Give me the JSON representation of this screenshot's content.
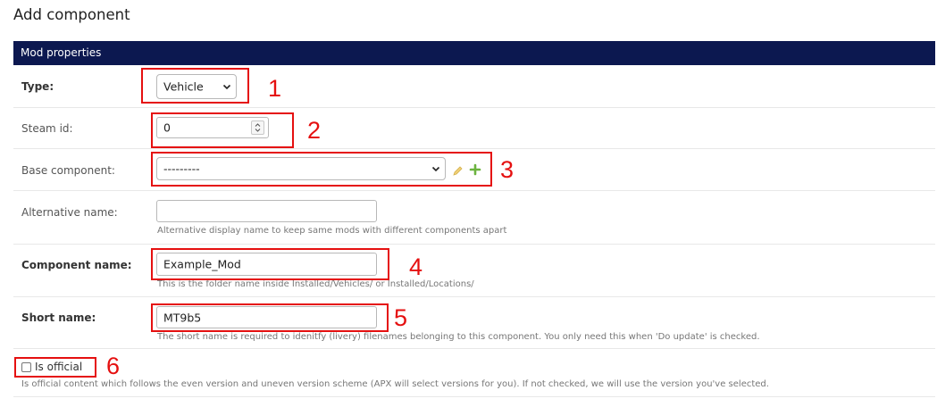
{
  "page": {
    "title": "Add component"
  },
  "section": {
    "title": "Mod properties"
  },
  "fields": {
    "type": {
      "label": "Type:",
      "value": "Vehicle",
      "annotation": "1"
    },
    "steam_id": {
      "label": "Steam id:",
      "value": "0",
      "annotation": "2"
    },
    "base_component": {
      "label": "Base component:",
      "value": "---------",
      "annotation": "3"
    },
    "alternative_name": {
      "label": "Alternative name:",
      "value": "",
      "help": "Alternative display name to keep same mods with different components apart"
    },
    "component_name": {
      "label": "Component name:",
      "value": "Example_Mod",
      "help": "This is the folder name inside Installed/Vehicles/ or Installed/Locations/",
      "annotation": "4"
    },
    "short_name": {
      "label": "Short name:",
      "value": "MT9b5",
      "help": "The short name is required to idenitfy (livery) filenames belonging to this component. You only need this when 'Do update' is checked.",
      "annotation": "5"
    },
    "is_official": {
      "label": "Is official",
      "checked": false,
      "help": "Is official content which follows the even version and uneven version scheme (APX will select versions for you). If not checked, we will use the version you've selected.",
      "annotation": "6"
    }
  },
  "icons": {
    "change": "pencil-icon",
    "add": "plus-icon"
  },
  "colors": {
    "header_bg": "#0c1850",
    "annotation": "#e51010",
    "add_icon": "#6cb33f",
    "change_icon": "#f0d078"
  }
}
